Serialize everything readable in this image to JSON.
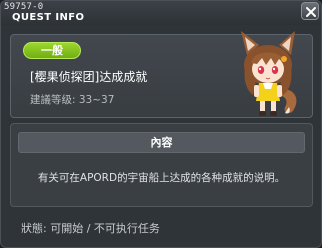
{
  "window": {
    "quest_id": "59757-0",
    "title": "QUEST INFO"
  },
  "quest": {
    "badge": "一般",
    "name": "[樱果侦探团]达成成就",
    "level": "建議等级: 33~37",
    "avatar": "fox-eared-girl-npc"
  },
  "content": {
    "header": "內容",
    "description": "有关可在APORD的宇宙船上达成的各种成就的说明。"
  },
  "status": {
    "text": "狀態: 可開始 / 不可执行任务"
  },
  "colors": {
    "badge_green": "#8bc823",
    "window_bg": "#2f3439",
    "panel_bg": "#3a3f44"
  }
}
